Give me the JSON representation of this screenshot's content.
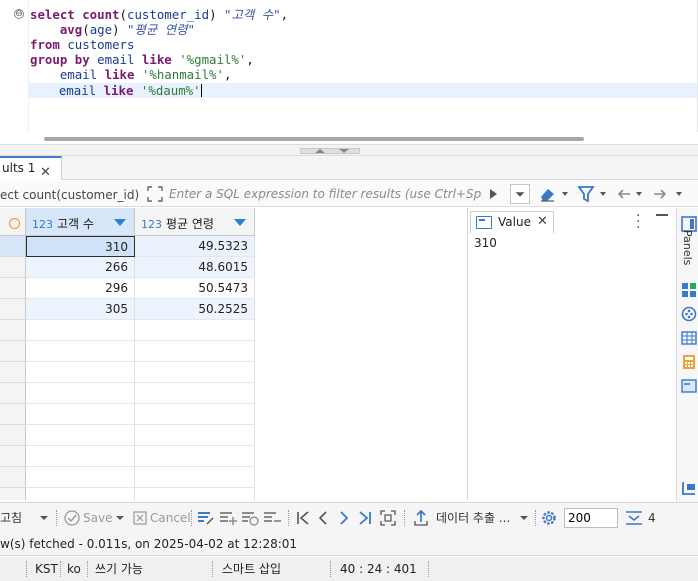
{
  "editor": {
    "lines": [
      [
        {
          "t": "select ",
          "c": "kw"
        },
        {
          "t": "count",
          "c": "fn"
        },
        {
          "t": "(",
          "c": "plain"
        },
        {
          "t": "customer_id",
          "c": "id"
        },
        {
          "t": ") ",
          "c": "plain"
        },
        {
          "t": "\"고객 수\"",
          "c": "alias"
        },
        {
          "t": ",",
          "c": "plain"
        }
      ],
      [
        {
          "t": "    ",
          "c": "plain"
        },
        {
          "t": "avg",
          "c": "fn"
        },
        {
          "t": "(",
          "c": "plain"
        },
        {
          "t": "age",
          "c": "id"
        },
        {
          "t": ") ",
          "c": "plain"
        },
        {
          "t": "\"평균 연령\"",
          "c": "alias"
        }
      ],
      [
        {
          "t": "from ",
          "c": "kw"
        },
        {
          "t": "customers",
          "c": "id"
        }
      ],
      [
        {
          "t": "group by ",
          "c": "kw"
        },
        {
          "t": "email ",
          "c": "id"
        },
        {
          "t": "like ",
          "c": "kw"
        },
        {
          "t": "'%gmail%'",
          "c": "str"
        },
        {
          "t": ",",
          "c": "plain"
        }
      ],
      [
        {
          "t": "    ",
          "c": "plain"
        },
        {
          "t": "email ",
          "c": "id"
        },
        {
          "t": "like ",
          "c": "kw"
        },
        {
          "t": "'%hanmail%'",
          "c": "str"
        },
        {
          "t": ",",
          "c": "plain"
        }
      ],
      [
        {
          "t": "    ",
          "c": "plain"
        },
        {
          "t": "email ",
          "c": "id"
        },
        {
          "t": "like ",
          "c": "kw"
        },
        {
          "t": "'%daum%'",
          "c": "str"
        }
      ]
    ],
    "fold_marker": "⊖"
  },
  "results_tab": {
    "label": "ults 1",
    "close": "✕"
  },
  "filter": {
    "query_preview": "ect count(customer_id) \"고객",
    "placeholder": "Enter a SQL expression to filter results (use Ctrl+Space)"
  },
  "grid": {
    "columns": [
      {
        "type": "123",
        "label": "고객 수"
      },
      {
        "type": "123",
        "label": "평균 연령"
      }
    ],
    "rows": [
      [
        "310",
        "49.5323"
      ],
      [
        "266",
        "48.6015"
      ],
      [
        "296",
        "50.5473"
      ],
      [
        "305",
        "50.2525"
      ]
    ],
    "empty_rows": 9
  },
  "value_panel": {
    "tab_label": "Value",
    "close": "✕",
    "value": "310"
  },
  "side_panel": {
    "label": "Panels"
  },
  "toolbar": {
    "edit_label": "고침",
    "save_label": "Save",
    "cancel_label": "Cancel",
    "export_label": "데이터 추출 ...",
    "fetch_size": "200",
    "row_count": "4"
  },
  "status_line": {
    "text": "w(s) fetched - 0.011s, on 2025-04-02 at 12:28:01"
  },
  "status_bar": {
    "timezone": "KST",
    "locale": "ko",
    "mode": "쓰기 가능",
    "insert_mode": "스마트 삽입",
    "cursor": "40 : 24 : 401"
  }
}
